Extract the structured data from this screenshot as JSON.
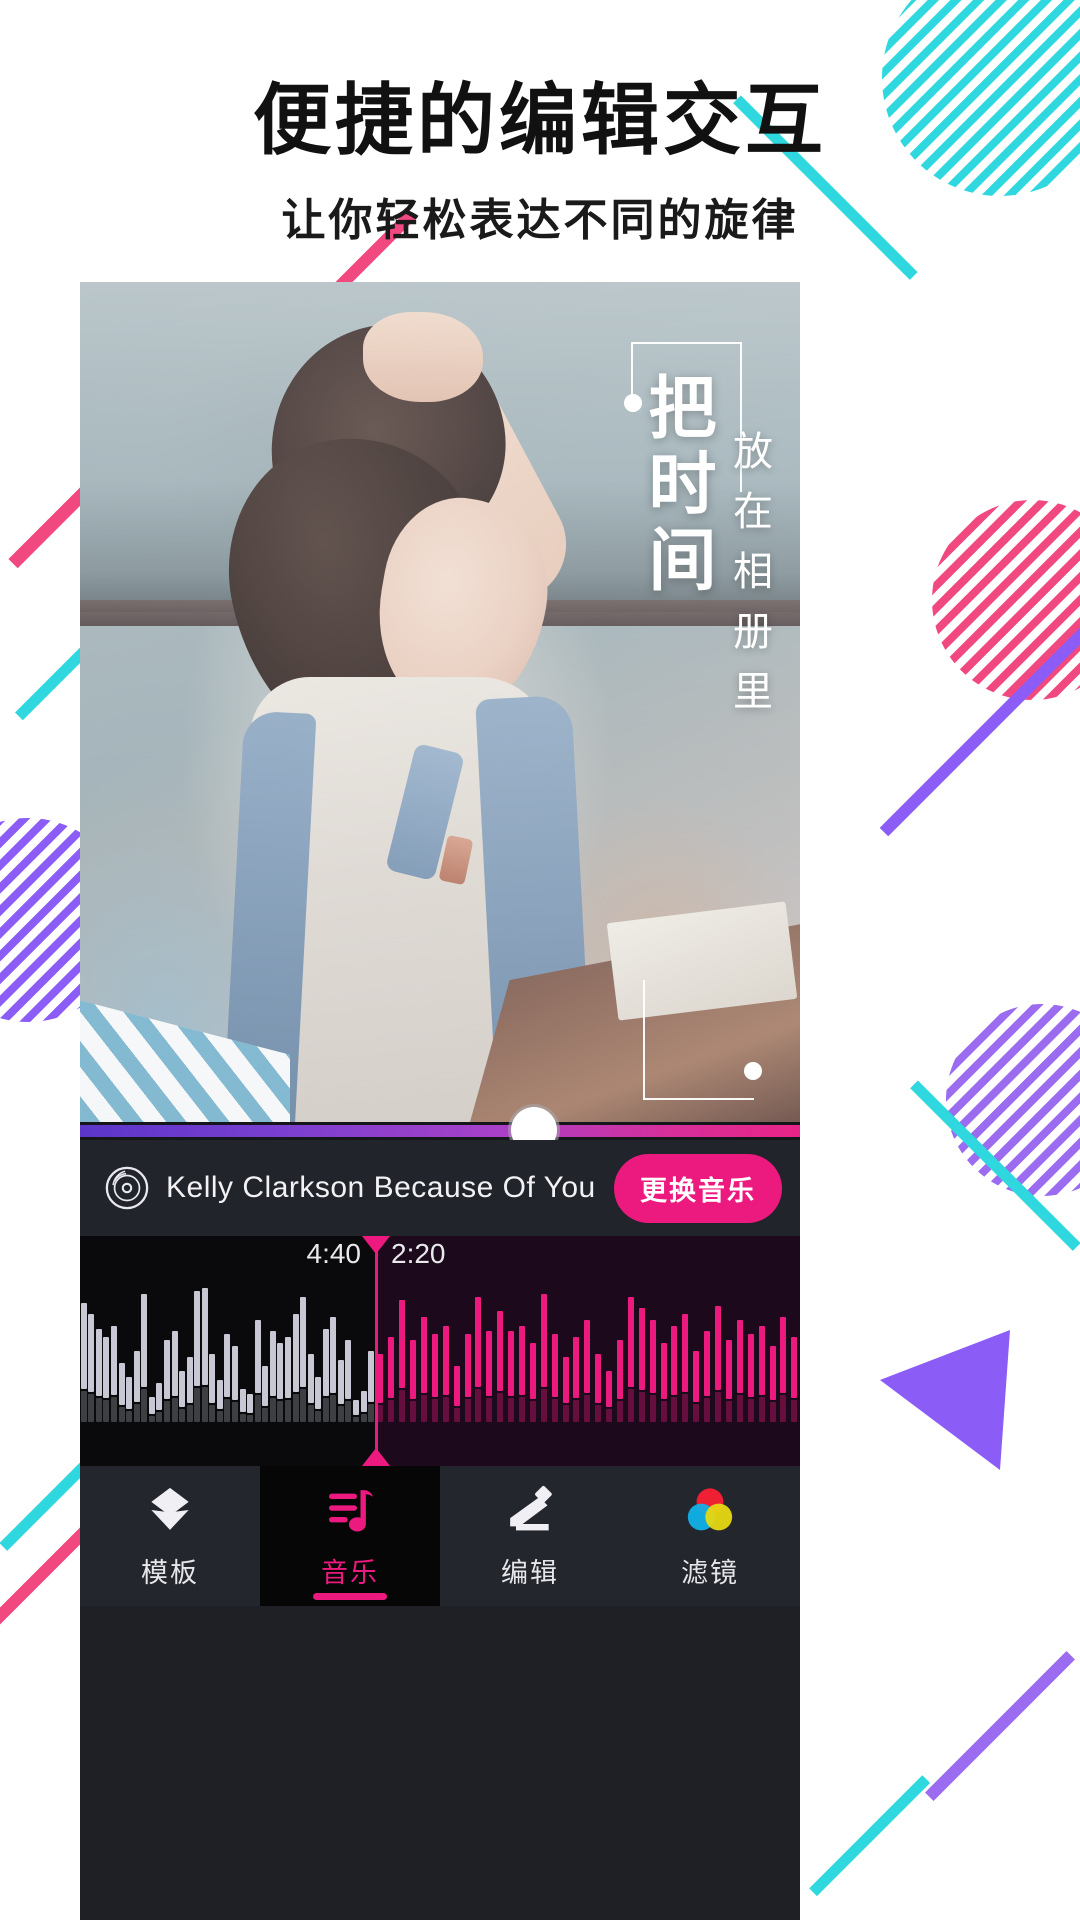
{
  "header": {
    "title": "便捷的编辑交互",
    "subtitle": "让你轻松表达不同的旋律"
  },
  "canvas": {
    "caption_main": "把时间",
    "caption_sub": "放在相册里"
  },
  "player": {
    "vinyl_icon": "vinyl-record-icon",
    "song": "Kelly  Clarkson  Because Of You",
    "change_music_label": "更换音乐",
    "progress_percent": 63,
    "total_time": "4:40",
    "current_time": "2:20",
    "accent_color": "#ec1a7f",
    "waveform": {
      "left_color": "#c7c8d4",
      "right_color": "#ec1a7f",
      "left_values": [
        82,
        74,
        64,
        58,
        66,
        40,
        30,
        48,
        88,
        16,
        26,
        56,
        62,
        34,
        44,
        90,
        92,
        46,
        28,
        60,
        52,
        22,
        18,
        70,
        38,
        62,
        54,
        58,
        74,
        86,
        46,
        30,
        64,
        72,
        42,
        56,
        14,
        20,
        48
      ],
      "right_values": [
        46,
        58,
        84,
        56,
        72,
        60,
        66,
        38,
        60,
        86,
        62,
        76,
        62,
        66,
        54,
        88,
        60,
        44,
        58,
        70,
        46,
        34,
        56,
        86,
        78,
        70,
        54,
        66,
        74,
        48,
        62,
        80,
        56,
        70,
        60,
        66,
        52,
        72,
        58
      ]
    }
  },
  "nav": {
    "items": [
      {
        "label": "模板",
        "icon": "layers-icon",
        "active": false
      },
      {
        "label": "音乐",
        "icon": "music-note-icon",
        "active": true
      },
      {
        "label": "编辑",
        "icon": "pencil-icon",
        "active": false
      },
      {
        "label": "滤镜",
        "icon": "filter-circles-icon",
        "active": false
      }
    ]
  },
  "decor": {
    "cyan": "#2fd8de",
    "pink": "#f0487f",
    "purple": "#8b5cf6",
    "magenta": "#e9338a"
  }
}
